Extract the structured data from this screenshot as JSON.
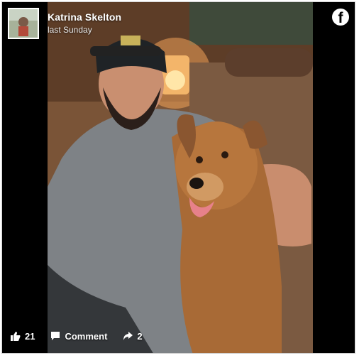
{
  "post": {
    "author": "Katrina Skelton",
    "timestamp": "last Sunday",
    "platform_icon": "facebook-logo-icon",
    "photo_description_icon": "photo"
  },
  "actions": {
    "likes_count": "21",
    "comment_label": "Comment",
    "shares_count": "2"
  },
  "colors": {
    "background": "#000000",
    "text": "#ffffff",
    "frame": "#cfcfcf"
  }
}
